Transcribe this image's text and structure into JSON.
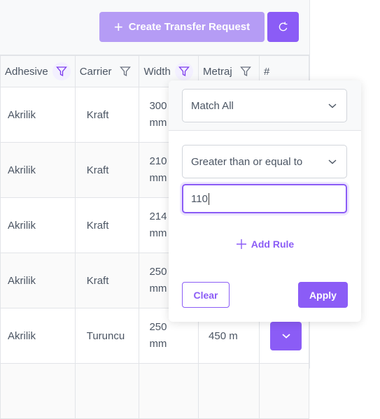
{
  "toolbar": {
    "create_label": "Create Transfer Request",
    "create_icon": "plus-icon",
    "refresh_icon": "refresh-icon"
  },
  "table": {
    "columns": [
      {
        "label": "Adhesive",
        "filter_active": true
      },
      {
        "label": "Carrier",
        "filter_active": false
      },
      {
        "label": "Width",
        "filter_active": true
      },
      {
        "label": "Metraj",
        "filter_active": false
      },
      {
        "label": "#"
      }
    ],
    "rows": [
      {
        "adhesive": "Akrilik",
        "carrier": "Kraft",
        "width_value": "300",
        "width_unit": "mm",
        "metraj": ""
      },
      {
        "adhesive": "Akrilik",
        "carrier": "Kraft",
        "width_value": "210",
        "width_unit": "mm",
        "metraj": ""
      },
      {
        "adhesive": "Akrilik",
        "carrier": "Kraft",
        "width_value": "214",
        "width_unit": "mm",
        "metraj": ""
      },
      {
        "adhesive": "Akrilik",
        "carrier": "Kraft",
        "width_value": "250",
        "width_unit": "mm",
        "metraj": ""
      },
      {
        "adhesive": "Akrilik",
        "carrier": "Turuncu",
        "width_value": "250",
        "width_unit": "mm",
        "metraj": "450 m"
      }
    ]
  },
  "filter_popup": {
    "match_mode": "Match All",
    "condition": "Greater than or equal to",
    "value": "110",
    "add_rule_label": "Add Rule",
    "clear_label": "Clear",
    "apply_label": "Apply"
  },
  "colors": {
    "accent": "#8b5cf6",
    "accent_light": "#b59cf5"
  }
}
